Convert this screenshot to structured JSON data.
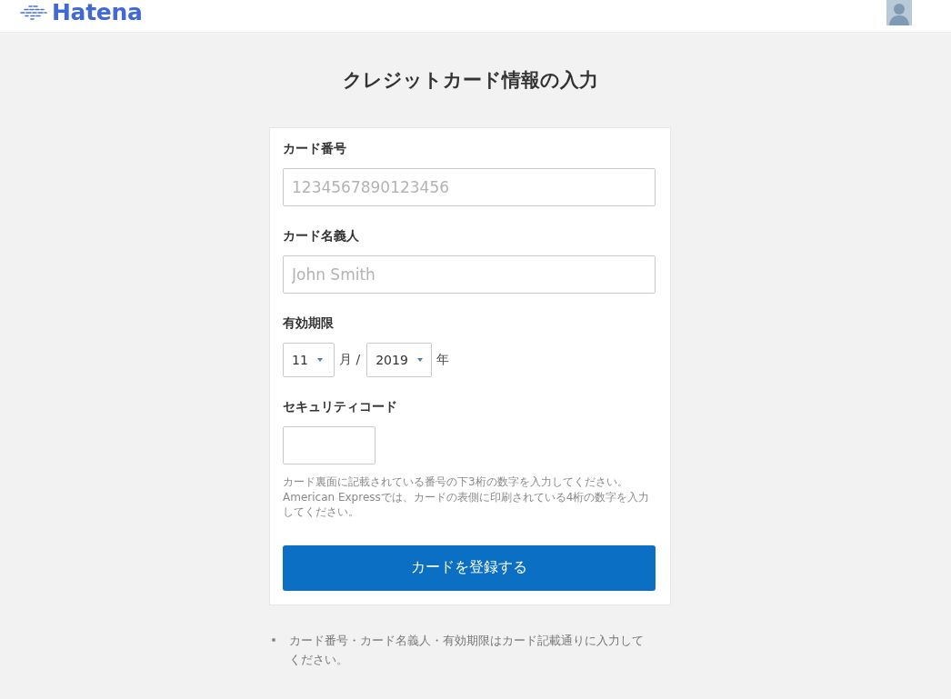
{
  "header": {
    "logo": "Hatena"
  },
  "title": "クレジットカード情報の入力",
  "form": {
    "fields": [
      {
        "kind": "text",
        "label": "カード番号",
        "placeholder": "1234567890123456"
      },
      {
        "kind": "text",
        "label": "カード名義人",
        "placeholder": "John Smith"
      },
      {
        "kind": "expiry",
        "label": "有効期限",
        "month": "11",
        "month_unit": "月 /",
        "year": "2019",
        "year_unit": "年"
      },
      {
        "kind": "code",
        "label": "セキュリティコード",
        "help": [
          "カード裏面に記載されている番号の下3桁の数字を入力してください。",
          "American Expressでは、カードの表側に印刷されている4桁の数字を入力してください。"
        ]
      }
    ],
    "submit": "カードを登録する"
  },
  "notes": [
    "カード番号・カード名義人・有効期限はカード記載通りに入力してください。"
  ]
}
